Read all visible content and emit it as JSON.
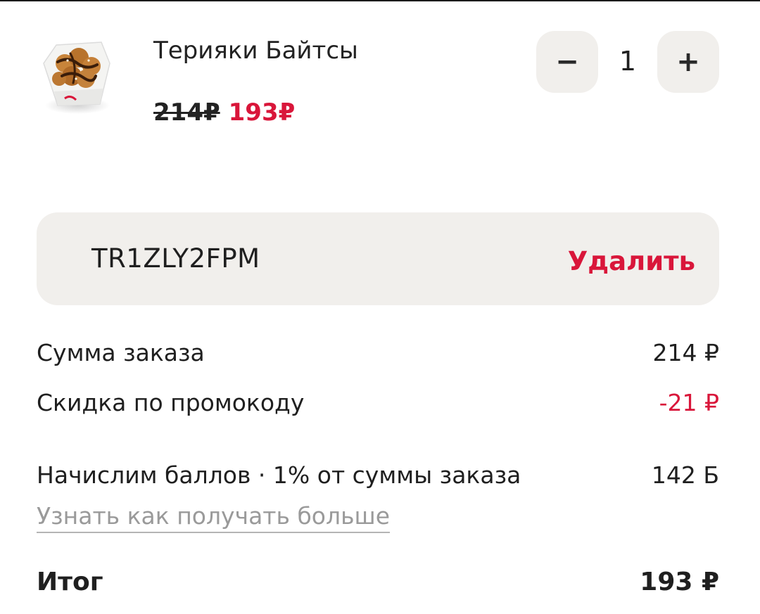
{
  "item": {
    "name": "Терияки Байтсы",
    "image_icon": "teriyaki-bites-image",
    "old_price": "214₽",
    "new_price": "193₽",
    "quantity": "1",
    "minus_label": "−",
    "plus_label": "+"
  },
  "promo": {
    "code": "TR1ZLY2FPM",
    "remove_label": "Удалить"
  },
  "summary": {
    "order_sum_label": "Сумма заказа",
    "order_sum_value": "214 ₽",
    "discount_label": "Скидка по промокоду",
    "discount_value": "-21 ₽",
    "points_label": "Начислим баллов · 1% от суммы заказа",
    "points_value": "142 Б",
    "learn_more_label": "Узнать как получать больше",
    "total_label": "Итог",
    "total_value": "193 ₽"
  },
  "colors": {
    "accent": "#d9163a",
    "panel": "#f1efec",
    "text": "#1f1f1f",
    "muted": "#9a9a9a"
  }
}
